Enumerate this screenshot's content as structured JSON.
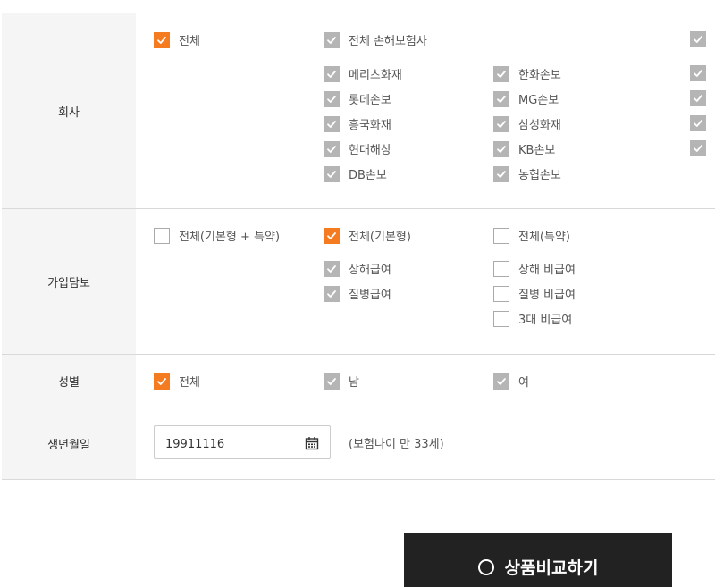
{
  "company": {
    "label": "회사",
    "options": [
      {
        "label": "전체",
        "state": "orange"
      },
      {
        "label": "전체 손해보험사",
        "state": "gray"
      },
      {
        "label": "",
        "state": "gray"
      },
      {
        "label": "메리츠화재",
        "state": "gray"
      },
      {
        "label": "한화손보",
        "state": "gray"
      },
      {
        "label": "",
        "state": "gray"
      },
      {
        "label": "롯데손보",
        "state": "gray"
      },
      {
        "label": "MG손보",
        "state": "gray"
      },
      {
        "label": "",
        "state": "gray"
      },
      {
        "label": "흥국화재",
        "state": "gray"
      },
      {
        "label": "삼성화재",
        "state": "gray"
      },
      {
        "label": "",
        "state": "gray"
      },
      {
        "label": "현대해상",
        "state": "gray"
      },
      {
        "label": "KB손보",
        "state": "gray"
      },
      {
        "label": "",
        "state": "gray"
      },
      {
        "label": "DB손보",
        "state": "gray"
      },
      {
        "label": "농협손보",
        "state": "gray"
      }
    ]
  },
  "coverage": {
    "label": "가입담보",
    "options": [
      {
        "label": "전체(기본형 + 특약)",
        "state": "empty"
      },
      {
        "label": "전체(기본형)",
        "state": "orange"
      },
      {
        "label": "전체(특약)",
        "state": "empty"
      },
      {
        "label": "상해급여",
        "state": "gray"
      },
      {
        "label": "상해 비급여",
        "state": "empty"
      },
      {
        "label": "질병급여",
        "state": "gray"
      },
      {
        "label": "질병 비급여",
        "state": "empty"
      },
      {
        "label": "3대 비급여",
        "state": "empty"
      }
    ]
  },
  "gender": {
    "label": "성별",
    "options": [
      {
        "label": "전체",
        "state": "orange"
      },
      {
        "label": "남",
        "state": "gray"
      },
      {
        "label": "여",
        "state": "gray"
      }
    ]
  },
  "birthdate": {
    "label": "생년월일",
    "value": "19911116",
    "age_note": "(보험나이 만  33세)",
    "icon": "calendar-icon"
  },
  "cta": {
    "label": "상품비교하기",
    "icon": "search-icon"
  },
  "colors": {
    "accent": "#f47b20",
    "checked_gray": "#b5b5b5",
    "button_bg": "#222222",
    "label_bg": "#f5f5f5"
  }
}
